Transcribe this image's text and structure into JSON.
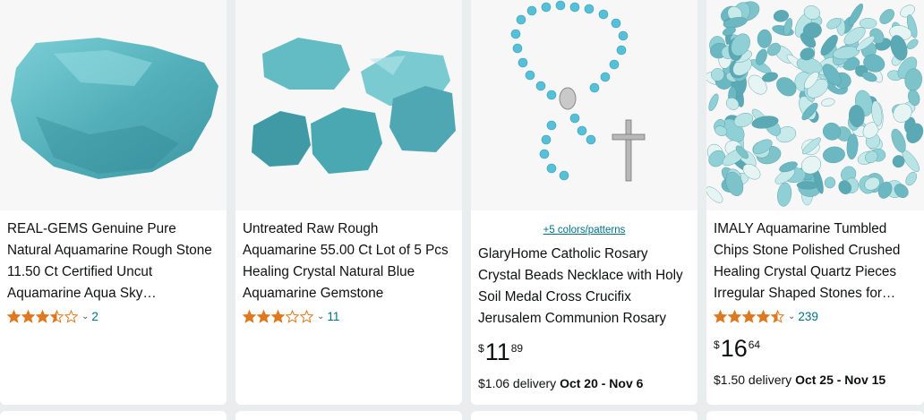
{
  "products": [
    {
      "title": "REAL-GEMS Genuine Pure Natural Aquamarine Rough Stone 11.50 Ct Certified Uncut Aquamarine Aqua Sky…",
      "rating": 3.5,
      "review_count": "2",
      "image": "rough-aquamarine-stone-image"
    },
    {
      "title": "Untreated Raw Rough Aquamarine 55.00 Ct Lot of 5 Pcs Healing Crystal Natural Blue Aquamarine Gemstone",
      "rating": 3,
      "review_count": "11",
      "image": "five-aquamarine-stones-image"
    },
    {
      "colors_link": "+5 colors/patterns",
      "title": "GlaryHome Catholic Rosary Crystal Beads Necklace with Holy Soil Medal Cross Crucifix Jerusalem Communion Rosary",
      "price_symbol": "$",
      "price_whole": "11",
      "price_fraction": "89",
      "delivery_prefix": "$1.06 delivery",
      "delivery_dates": "Oct 20 - Nov 6",
      "image": "rosary-necklace-image"
    },
    {
      "title": "IMALY Aquamarine Tumbled Chips Stone Polished Crushed Healing Crystal Quartz Pieces Irregular Shaped Stones for…",
      "rating": 4.5,
      "review_count": "239",
      "price_symbol": "$",
      "price_whole": "16",
      "price_fraction": "64",
      "delivery_prefix": "$1.50 delivery",
      "delivery_dates": "Oct 25 - Nov 15",
      "image": "tumbled-chips-image"
    }
  ],
  "colors": {
    "star": "#de7921",
    "link": "#007185",
    "aqua": "#5fb5bf"
  }
}
